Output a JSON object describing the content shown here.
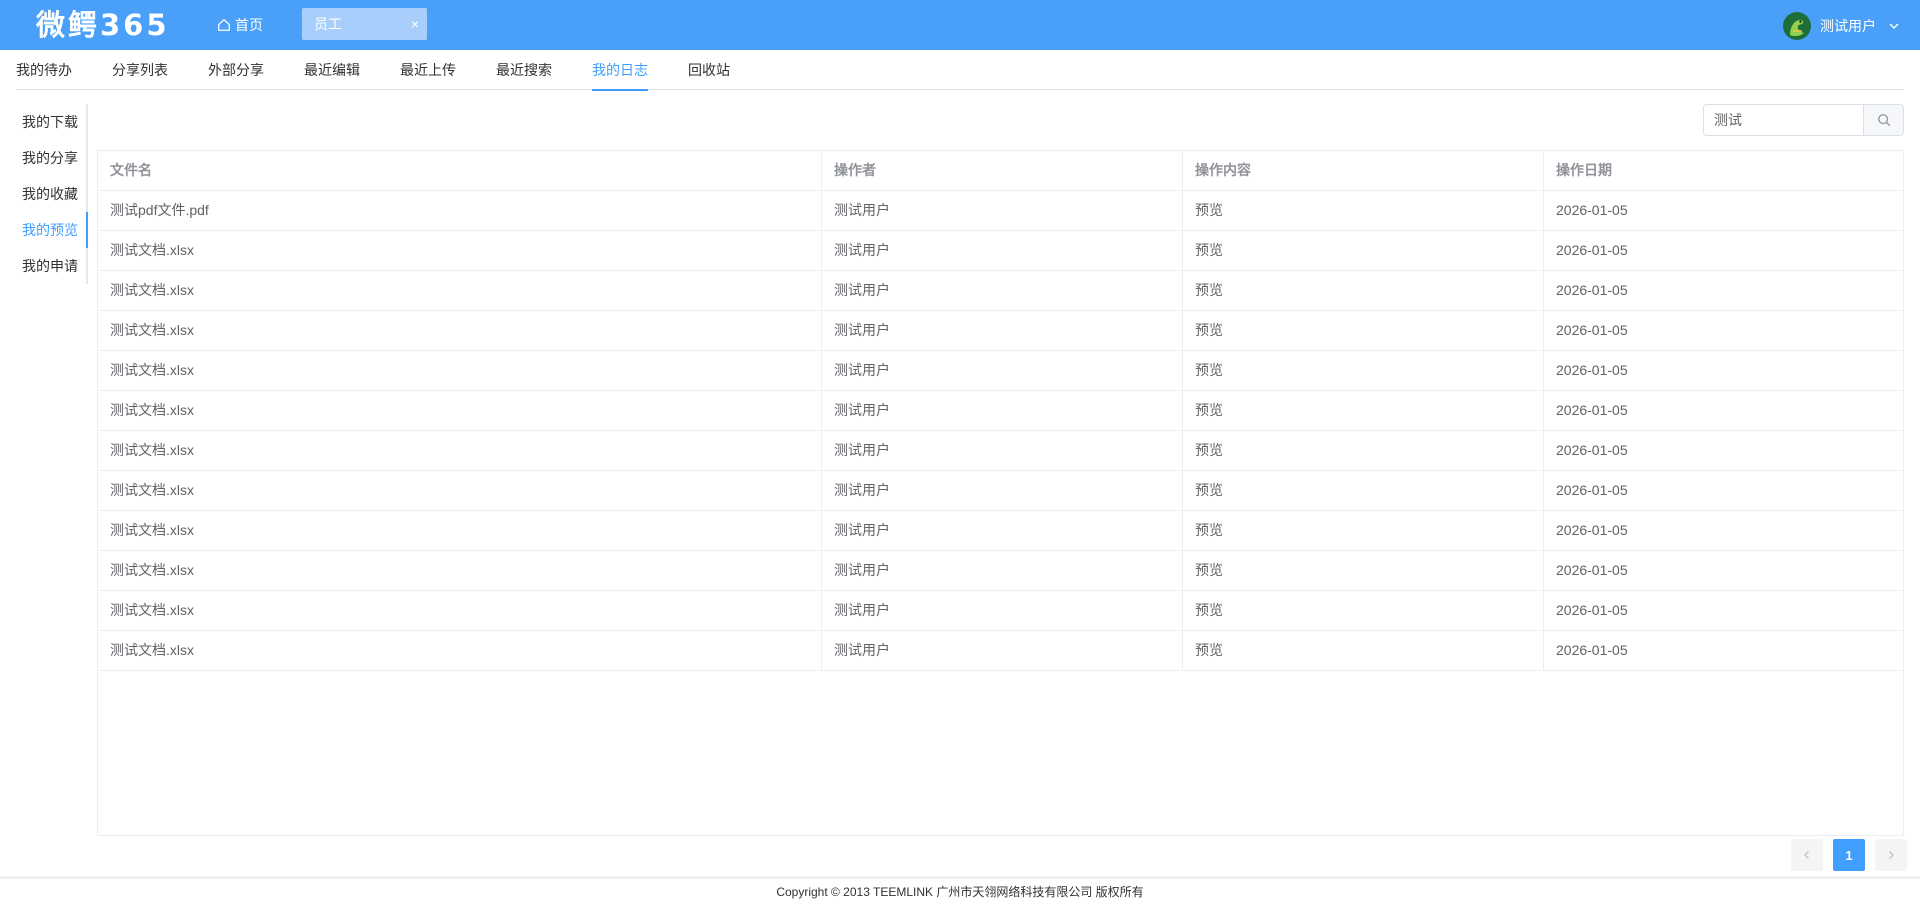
{
  "header": {
    "logo": "微鳄365",
    "home_label": "首页",
    "open_tab": {
      "label": "员工",
      "close": "×"
    },
    "user_name": "测试用户"
  },
  "colors": {
    "header_bg": "#4aa0f8",
    "accent": "#409eff",
    "tab_bg": "#a8cffb"
  },
  "nav_tabs": [
    {
      "label": "我的待办",
      "active": false
    },
    {
      "label": "分享列表",
      "active": false
    },
    {
      "label": "外部分享",
      "active": false
    },
    {
      "label": "最近编辑",
      "active": false
    },
    {
      "label": "最近上传",
      "active": false
    },
    {
      "label": "最近搜索",
      "active": false
    },
    {
      "label": "我的日志",
      "active": true
    },
    {
      "label": "回收站",
      "active": false
    }
  ],
  "side_menu": [
    {
      "label": "我的下载",
      "active": false
    },
    {
      "label": "我的分享",
      "active": false
    },
    {
      "label": "我的收藏",
      "active": false
    },
    {
      "label": "我的预览",
      "active": true
    },
    {
      "label": "我的申请",
      "active": false
    }
  ],
  "search": {
    "value": "测试",
    "icon": "search-icon"
  },
  "table": {
    "columns": [
      "文件名",
      "操作者",
      "操作内容",
      "操作日期"
    ],
    "rows": [
      [
        "测试pdf文件.pdf",
        "测试用户",
        "预览",
        "2026-01-05"
      ],
      [
        "测试文档.xlsx",
        "测试用户",
        "预览",
        "2026-01-05"
      ],
      [
        "测试文档.xlsx",
        "测试用户",
        "预览",
        "2026-01-05"
      ],
      [
        "测试文档.xlsx",
        "测试用户",
        "预览",
        "2026-01-05"
      ],
      [
        "测试文档.xlsx",
        "测试用户",
        "预览",
        "2026-01-05"
      ],
      [
        "测试文档.xlsx",
        "测试用户",
        "预览",
        "2026-01-05"
      ],
      [
        "测试文档.xlsx",
        "测试用户",
        "预览",
        "2026-01-05"
      ],
      [
        "测试文档.xlsx",
        "测试用户",
        "预览",
        "2026-01-05"
      ],
      [
        "测试文档.xlsx",
        "测试用户",
        "预览",
        "2026-01-05"
      ],
      [
        "测试文档.xlsx",
        "测试用户",
        "预览",
        "2026-01-05"
      ],
      [
        "测试文档.xlsx",
        "测试用户",
        "预览",
        "2026-01-05"
      ],
      [
        "测试文档.xlsx",
        "测试用户",
        "预览",
        "2026-01-05"
      ]
    ]
  },
  "pagination": {
    "current_page": "1",
    "prev_icon": "chevron-left-icon",
    "next_icon": "chevron-right-icon"
  },
  "footer": {
    "copyright": "Copyright © 2013 TEEMLINK 广州市天翎网络科技有限公司 版权所有"
  }
}
